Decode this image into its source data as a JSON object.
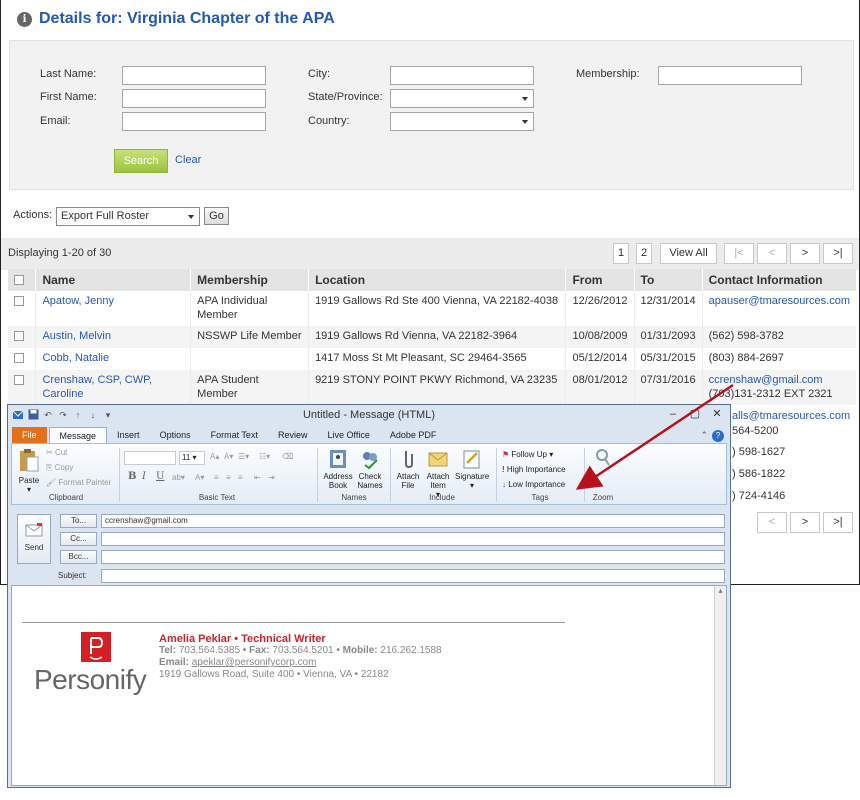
{
  "page": {
    "title": "Details for: Virginia Chapter of the APA",
    "info_icon": "i"
  },
  "search_form": {
    "last_name_label": "Last Name:",
    "first_name_label": "First Name:",
    "email_label": "Email:",
    "city_label": "City:",
    "state_label": "State/Province:",
    "country_label": "Country:",
    "membership_label": "Membership:",
    "search_button": "Search",
    "clear_link": "Clear"
  },
  "actions": {
    "label": "Actions:",
    "selected": "Export Full Roster",
    "go_button": "Go"
  },
  "pager": {
    "displaying": "Displaying 1-20 of 30",
    "page1": "1",
    "page2": "2",
    "view_all": "View All",
    "first": "|<",
    "prev": "<",
    "next": ">",
    "last": ">|"
  },
  "table": {
    "headers": [
      "Name",
      "Membership",
      "Location",
      "From",
      "To",
      "Contact Information"
    ],
    "rows": [
      {
        "name": "Apatow, Jenny",
        "membership": "APA Individual Member",
        "location": "1919 Gallows Rd Ste 400 Vienna, VA 22182-4038",
        "from": "12/26/2012",
        "to": "12/31/2014",
        "email": "apauser@tmaresources.com",
        "phone": ""
      },
      {
        "name": "Austin, Melvin",
        "membership": "NSSWP Life Member",
        "location": "1919 Gallows Rd Vienna, VA 22182-3964",
        "from": "10/08/2009",
        "to": "01/31/2093",
        "email": "",
        "phone": "(562) 598-3782"
      },
      {
        "name": "Cobb, Natalie",
        "membership": "",
        "location": "1417 Moss St Mt Pleasant, SC 29464-3565",
        "from": "05/12/2014",
        "to": "05/31/2015",
        "email": "",
        "phone": "(803) 884-2697"
      },
      {
        "name": "Crenshaw, CSP, CWP, Caroline",
        "membership": "APA Student Member",
        "location": "9219 STONY POINT PKWY Richmond, VA 23235",
        "from": "08/01/2012",
        "to": "07/31/2016",
        "email": "ccrenshaw@gmail.com",
        "phone": "(703)131-2312 EXT 2321"
      }
    ],
    "partial_right": [
      "alls@tmaresources.com",
      "564-5200",
      ") 598-1627",
      ") 586-1822",
      ") 724-4146"
    ]
  },
  "outlook": {
    "title": "Untitled  -  Message (HTML)",
    "win_min": "–",
    "win_max": "▢",
    "win_close": "✕",
    "tabs": [
      "File",
      "Message",
      "Insert",
      "Options",
      "Format Text",
      "Review",
      "Live Office",
      "Adobe PDF"
    ],
    "help": "?",
    "clipboard": {
      "paste": "Paste",
      "cut": "Cut",
      "copy": "Copy",
      "format_painter": "Format Painter",
      "label": "Clipboard"
    },
    "basic_text": {
      "font_size": "11",
      "bold": "B",
      "italic": "I",
      "underline": "U",
      "label": "Basic Text"
    },
    "names": {
      "address_book": "Address Book",
      "check_names": "Check Names",
      "label": "Names"
    },
    "include": {
      "attach_file": "Attach File",
      "attach_item": "Attach Item",
      "signature": "Signature",
      "label": "Include"
    },
    "tags": {
      "follow_up": "Follow Up",
      "high": "High Importance",
      "low": "Low Importance",
      "label": "Tags"
    },
    "zoom": {
      "zoom": "Zoom",
      "label": "Zoom"
    },
    "send": "Send",
    "to_button": "To...",
    "cc_button": "Cc...",
    "bcc_button": "Bcc...",
    "subject_label": "Subject:",
    "to_value": "ccrenshaw@gmail.com",
    "cc_value": "",
    "bcc_value": "",
    "subject_value": ""
  },
  "signature": {
    "name_line": "Amelia Peklar • Technical Writer",
    "tel_label": "Tel:",
    "tel": "703.564.5385",
    "fax_label": "• Fax:",
    "fax": "703.564.5201",
    "mobile_label": "• Mobile:",
    "mobile": "216.262.1588",
    "email_label": "Email:",
    "email": "apeklar@personifycorp.com",
    "address": "1919 Gallows Road, Suite 400 • Vienna, VA • 22182",
    "logo_text": "Personify"
  },
  "colors": {
    "link": "#2458b3",
    "arrow": "#b5121b",
    "search_button": "#9ac43c",
    "file_tab": "#e5701c"
  }
}
